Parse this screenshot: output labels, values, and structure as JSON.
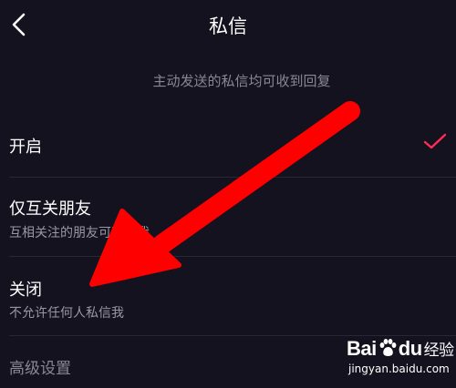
{
  "header": {
    "title": "私信",
    "back_icon": "chevron-left-icon"
  },
  "subtitle": "主动发送的私信均可收到回复",
  "options": [
    {
      "label": "开启",
      "description": "",
      "selected": true
    },
    {
      "label": "仅互关朋友",
      "description": "互相关注的朋友可私信我",
      "selected": false
    },
    {
      "label": "关闭",
      "description": "不允许任何人私信我",
      "selected": false
    }
  ],
  "advanced": {
    "label": "高级设置"
  },
  "watermark": {
    "brand_bai": "Bai",
    "brand_du": "du",
    "brand_product": "经验",
    "domain": "jingyan.baidu.com"
  },
  "colors": {
    "background": "#15121f",
    "accent": "#fe2c55",
    "annotation_arrow": "#ff0000",
    "secondary_text": "#8a8794"
  }
}
